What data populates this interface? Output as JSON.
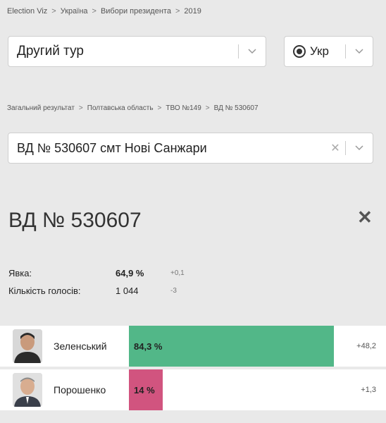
{
  "breadcrumb_top": [
    "Election Viz",
    "Україна",
    "Вибори президента",
    "2019"
  ],
  "round_select": {
    "value": "Другий тур"
  },
  "language_select": {
    "value": "Укр"
  },
  "breadcrumb_mid": [
    "Загальний результат",
    "Полтавська область",
    "ТВО №149",
    "ВД № 530607"
  ],
  "station_select": {
    "value": "ВД № 530607 смт Нові Санжари"
  },
  "title": "ВД № 530607",
  "stats": {
    "turnout": {
      "label": "Явка:",
      "value": "64,9 %",
      "delta": "+0,1"
    },
    "votes": {
      "label": "Кількість голосів:",
      "value": "1 044",
      "delta": "-3"
    }
  },
  "candidates": [
    {
      "name": "Зеленський",
      "percent_label": "84,3 %",
      "share": 0.843,
      "delta": "+48,2",
      "color": "#52b788"
    },
    {
      "name": "Порошенко",
      "percent_label": "14 %",
      "share": 0.14,
      "delta": "+1,3",
      "color": "#d1547f"
    }
  ],
  "icons": {
    "chevron": "chevron-down-icon",
    "clear": "clear-icon",
    "close": "close-icon",
    "globe": "globe-icon"
  }
}
